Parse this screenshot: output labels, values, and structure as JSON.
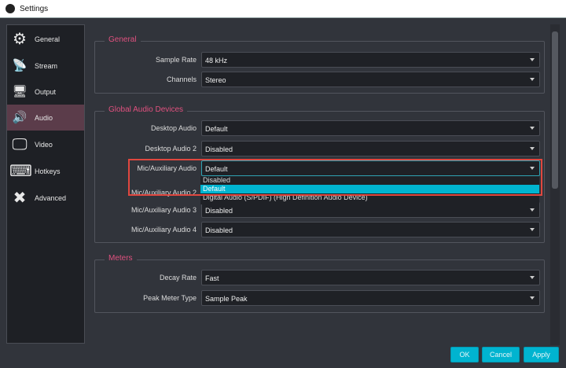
{
  "window": {
    "title": "Settings"
  },
  "sidebar": {
    "items": [
      {
        "label": "General",
        "icon": "gear-icon",
        "glyph": "⚙"
      },
      {
        "label": "Stream",
        "icon": "broadcast-icon",
        "glyph": "📡"
      },
      {
        "label": "Output",
        "icon": "output-icon",
        "glyph": "🖥"
      },
      {
        "label": "Audio",
        "icon": "speaker-icon",
        "glyph": "🔊"
      },
      {
        "label": "Video",
        "icon": "monitor-icon",
        "glyph": "🖵"
      },
      {
        "label": "Hotkeys",
        "icon": "keyboard-icon",
        "glyph": "⌨"
      },
      {
        "label": "Advanced",
        "icon": "tools-icon",
        "glyph": "✖"
      }
    ],
    "selected": "Audio"
  },
  "general": {
    "title": "General",
    "sample_rate_label": "Sample Rate",
    "sample_rate": "48 kHz",
    "channels_label": "Channels",
    "channels": "Stereo"
  },
  "devices": {
    "title": "Global Audio Devices",
    "desktop_label": "Desktop Audio",
    "desktop": "Default",
    "desktop2_label": "Desktop Audio 2",
    "desktop2": "Disabled",
    "mic_label": "Mic/Auxiliary Audio",
    "mic": "Default",
    "mic2_label": "Mic/Auxiliary Audio 2",
    "mic3_label": "Mic/Auxiliary Audio 3",
    "mic3": "Disabled",
    "mic4_label": "Mic/Auxiliary Audio 4",
    "mic4": "Disabled",
    "dropdown_options": [
      "Disabled",
      "Default",
      "Digital Audio (S/PDIF) (High Definition Audio Device)"
    ],
    "highlighted": "Default"
  },
  "meters": {
    "title": "Meters",
    "decay_label": "Decay Rate",
    "decay": "Fast",
    "peak_label": "Peak Meter Type",
    "peak": "Sample Peak"
  },
  "buttons": {
    "ok": "OK",
    "cancel": "Cancel",
    "apply": "Apply"
  }
}
